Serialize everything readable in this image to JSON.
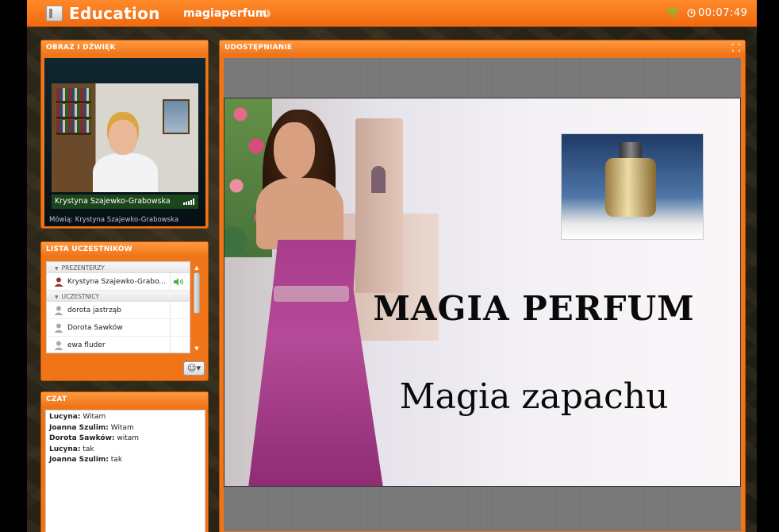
{
  "topbar": {
    "app_title": "Education",
    "room_name": "magiaperfum",
    "timer": "00:07:49",
    "icons": {
      "logo": "book-icon",
      "info": "info-icon",
      "connection": "wifi-icon",
      "clock": "clock-icon"
    }
  },
  "video_panel": {
    "title": "OBRAZ I DŹWIĘK",
    "camera_caption": "Krystyna Szajewko-Grabowska",
    "speaking_label": "Mówią: Krystyna Szajewko-Grabowska"
  },
  "participants": {
    "title": "LISTA UCZESTNIKÓW",
    "groups": [
      {
        "name": "PREZENTERZY",
        "members": [
          "Krystyna Szajewko-Grabo..."
        ]
      },
      {
        "name": "UCZESTNICY",
        "members": [
          "dorota jastrząb",
          "Dorota Sawków",
          "ewa fluder"
        ]
      }
    ],
    "emoji_button": "☺▾"
  },
  "chat": {
    "title": "CZAT",
    "messages": [
      {
        "author": "Lucyna:",
        "text": "Witam"
      },
      {
        "author": "Joanna Szulim:",
        "text": "Witam"
      },
      {
        "author": "Dorota Sawków:",
        "text": "witam"
      },
      {
        "author": "Lucyna:",
        "text": "tak"
      },
      {
        "author": "Joanna Szulim:",
        "text": "tak"
      }
    ]
  },
  "sharing": {
    "title": "UDOSTĘPNIANIE",
    "slide_title": "MAGIA PERFUM",
    "slide_subtitle": "Magia zapachu"
  },
  "colors": {
    "accent": "#f07418",
    "accent_dark": "#c45200",
    "background": "#2a2618"
  }
}
